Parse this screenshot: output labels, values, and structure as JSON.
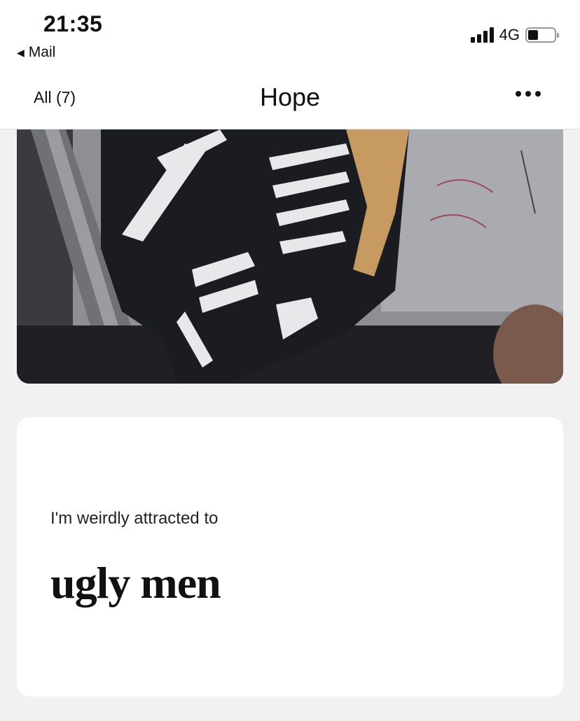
{
  "status_bar": {
    "time": "21:35",
    "back_app": "Mail",
    "network": "4G",
    "signal_icon": "cellular-signal-icon",
    "battery_icon": "battery-icon",
    "battery_level": 0.4
  },
  "nav": {
    "back_label": "All (7)",
    "title": "Hope",
    "more_icon": "ellipsis-icon"
  },
  "photo": {
    "description_icon": "profile-photo"
  },
  "prompt": {
    "question": "I'm weirdly attracted to",
    "answer": "ugly men"
  }
}
